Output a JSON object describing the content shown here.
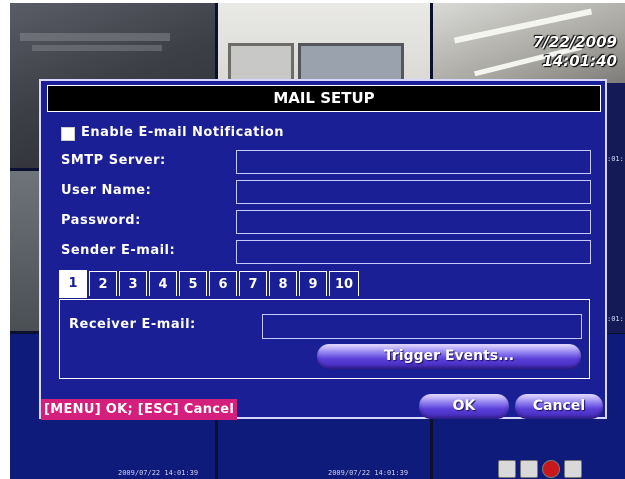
{
  "osd": {
    "date": "7/22/2009",
    "time": "14:01:40",
    "side_timestamp_right_1": ":01:",
    "side_timestamp_right_2": ":01:",
    "bottom_timestamp_1": "2009/07/22 14:01:39",
    "bottom_timestamp_2": "2009/07/22 14:01:39"
  },
  "dialog": {
    "title": "MAIL SETUP",
    "enable_label": "Enable E-mail Notification",
    "enable_checked": false,
    "fields": [
      {
        "label": "SMTP Server:",
        "value": ""
      },
      {
        "label": "User Name:",
        "value": ""
      },
      {
        "label": "Password:",
        "value": ""
      },
      {
        "label": "Sender E-mail:",
        "value": ""
      }
    ],
    "tabs": [
      "1",
      "2",
      "3",
      "4",
      "5",
      "6",
      "7",
      "8",
      "9",
      "10"
    ],
    "active_tab": "1",
    "receiver_label": "Receiver E-mail:",
    "receiver_value": "",
    "trigger_button": "Trigger Events...",
    "hint": "[MENU] OK; [ESC] Cancel",
    "ok_button": "OK",
    "cancel_button": "Cancel"
  },
  "colors": {
    "dialog_bg": "#1b1f95",
    "hint_bg": "#d4207c",
    "title_bg": "#000000"
  }
}
